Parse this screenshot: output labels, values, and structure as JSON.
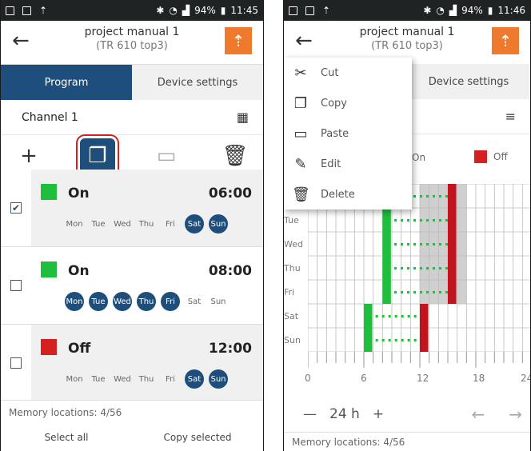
{
  "left": {
    "status": {
      "battery": "94%",
      "time": "11:45"
    },
    "title": "project manual 1",
    "subtitle": "(TR 610 top3)",
    "tabs": [
      {
        "label": "Program"
      },
      {
        "label": "Device settings"
      }
    ],
    "channel": "Channel 1",
    "entries": [
      {
        "checked": true,
        "state": "On",
        "color": "#1fbe3c",
        "time": "06:00",
        "days": [
          {
            "l": "Mon",
            "on": false
          },
          {
            "l": "Tue",
            "on": false
          },
          {
            "l": "Wed",
            "on": false
          },
          {
            "l": "Thu",
            "on": false
          },
          {
            "l": "Fri",
            "on": false
          },
          {
            "l": "Sat",
            "on": true
          },
          {
            "l": "Sun",
            "on": true
          }
        ]
      },
      {
        "checked": false,
        "state": "On",
        "color": "#1fbe3c",
        "time": "08:00",
        "days": [
          {
            "l": "Mon",
            "on": true
          },
          {
            "l": "Tue",
            "on": true
          },
          {
            "l": "Wed",
            "on": true
          },
          {
            "l": "Thu",
            "on": true
          },
          {
            "l": "Fri",
            "on": true
          },
          {
            "l": "Sat",
            "on": false
          },
          {
            "l": "Sun",
            "on": false
          }
        ]
      },
      {
        "checked": false,
        "state": "Off",
        "color": "#d61f1f",
        "time": "12:00",
        "days": [
          {
            "l": "Mon",
            "on": false
          },
          {
            "l": "Tue",
            "on": false
          },
          {
            "l": "Wed",
            "on": false
          },
          {
            "l": "Thu",
            "on": false
          },
          {
            "l": "Fri",
            "on": false
          },
          {
            "l": "Sat",
            "on": true
          },
          {
            "l": "Sun",
            "on": true
          }
        ]
      }
    ],
    "memory": "Memory locations: 4/56",
    "select_all": "Select all",
    "copy_selected": "Copy selected"
  },
  "right": {
    "status": {
      "battery": "94%",
      "time": "11:46"
    },
    "title": "project manual 1",
    "subtitle": "(TR 610 top3)",
    "tab_device": "Device settings",
    "legend_on": "On",
    "legend_off": "Off",
    "menu": [
      {
        "icon": "scissors-icon",
        "glyph": "✂",
        "label": "Cut"
      },
      {
        "icon": "copy-icon",
        "glyph": "❐",
        "label": "Copy"
      },
      {
        "icon": "paste-icon",
        "glyph": "▭",
        "label": "Paste"
      },
      {
        "icon": "pencil-icon",
        "glyph": "✎",
        "label": "Edit"
      },
      {
        "icon": "trash-icon",
        "glyph": "🗑",
        "label": "Delete"
      }
    ],
    "day_labels": [
      "Tue",
      "Wed",
      "Thu",
      "Fri",
      "Sat",
      "Sun"
    ],
    "x_ticks": [
      "0",
      "6",
      "12",
      "18",
      "24"
    ],
    "zoom": "24 h",
    "memory": "Memory locations: 4/56"
  }
}
